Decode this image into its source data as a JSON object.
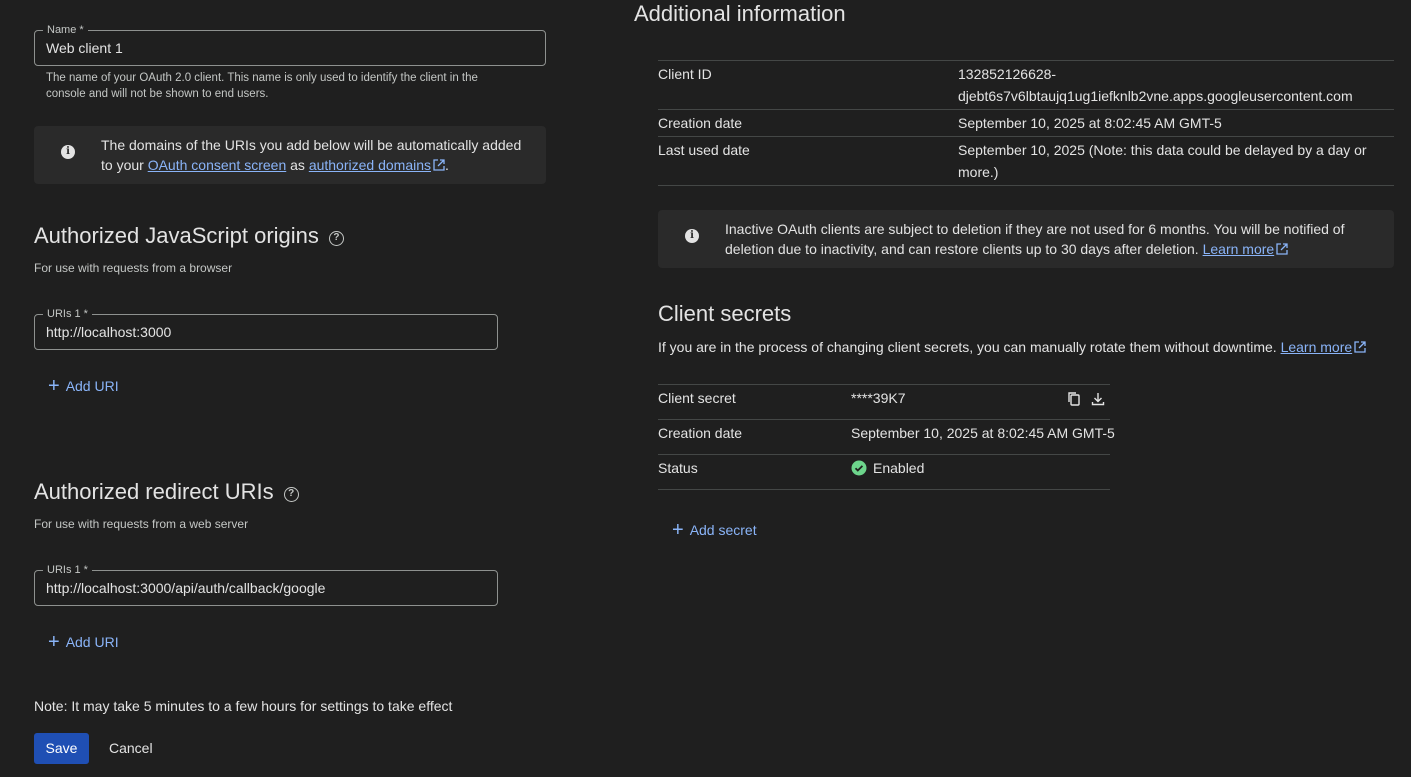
{
  "name_field": {
    "label": "Name *",
    "value": "Web client 1",
    "hint_line1": "The name of your OAuth 2.0 client. This name is only used to identify the client in the",
    "hint_line2": "console and will not be shown to end users."
  },
  "domains_banner": {
    "line1": "The domains of the URIs you add below will be automatically added",
    "to_your": "to your",
    "consent_link": "OAuth consent screen",
    "as": "as",
    "domains_link": "authorized domains",
    "period": "."
  },
  "js_origins": {
    "title": "Authorized JavaScript origins",
    "subtitle": "For use with requests from a browser",
    "uri_label": "URIs 1 *",
    "uri_value": "http://localhost:3000",
    "add_label": "Add URI"
  },
  "redirect_uris": {
    "title": "Authorized redirect URIs",
    "subtitle": "For use with requests from a web server",
    "uri_label": "URIs 1 *",
    "uri_value": "http://localhost:3000/api/auth/callback/google",
    "add_label": "Add URI"
  },
  "note": "Note: It may take 5 minutes to a few hours for settings to take effect",
  "actions": {
    "save": "Save",
    "cancel": "Cancel"
  },
  "additional_info": {
    "title": "Additional information",
    "rows": [
      {
        "label": "Client ID",
        "value_line1": "132852126628-",
        "value_line2": "djebt6s7v6lbtaujq1ug1iefknlb2vne.apps.googleusercontent.com"
      },
      {
        "label": "Creation date",
        "value_line1": "September 10, 2025 at 8:02:45 AM GMT-5"
      },
      {
        "label": "Last used date",
        "value_line1": "September 10, 2025 (Note: this data could be delayed by a day or",
        "value_line2": "more.)"
      }
    ]
  },
  "inactive_banner": {
    "line1": "Inactive OAuth clients are subject to deletion if they are not used for 6 months. You will be notified of",
    "line2": "deletion due to inactivity, and can restore clients up to 30 days after deletion.",
    "link": "Learn more"
  },
  "client_secrets": {
    "title": "Client secrets",
    "description": "If you are in the process of changing client secrets, you can manually rotate them without downtime.",
    "link": "Learn more",
    "rows": [
      {
        "label": "Client secret",
        "value": "****39K7"
      },
      {
        "label": "Creation date",
        "value": "September 10, 2025 at 8:02:45 AM GMT-5"
      },
      {
        "label": "Status",
        "value": "Enabled"
      }
    ],
    "add_label": "Add secret"
  },
  "colors": {
    "background": "#1f1f1f",
    "link": "#8ab4f8",
    "primary_button": "#1f4fb4",
    "enabled_green": "#6dd58c"
  },
  "icons": [
    "info-icon",
    "help-icon",
    "plus-icon",
    "external-link-icon",
    "copy-icon",
    "download-icon",
    "check-circle-icon"
  ]
}
